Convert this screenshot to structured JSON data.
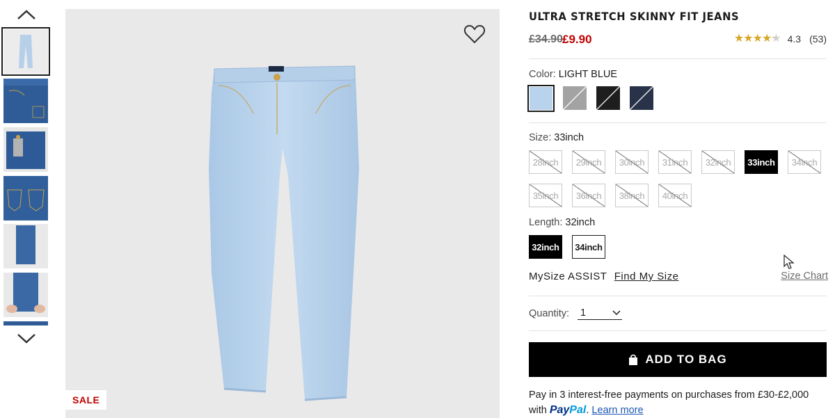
{
  "product": {
    "title": "ULTRA STRETCH SKINNY FIT JEANS",
    "price_original": "£34.90",
    "price_sale": "£9.90",
    "rating_value": "4.3",
    "rating_count": "(53)",
    "rating_stars": 4.3,
    "sale_badge": "SALE"
  },
  "color": {
    "label": "Color:",
    "selected": "LIGHT BLUE",
    "swatches": [
      {
        "name": "light-blue",
        "hex": "#b9d3ec",
        "available": true,
        "selected": true
      },
      {
        "name": "gray",
        "hex": "#a3a3a3",
        "available": false,
        "selected": false
      },
      {
        "name": "black",
        "hex": "#1e1e1e",
        "available": false,
        "selected": false
      },
      {
        "name": "navy",
        "hex": "#283349",
        "available": false,
        "selected": false
      }
    ]
  },
  "size": {
    "label": "Size:",
    "selected": "33inch",
    "options": [
      {
        "label": "28inch",
        "state": "oos"
      },
      {
        "label": "29inch",
        "state": "oos"
      },
      {
        "label": "30inch",
        "state": "oos"
      },
      {
        "label": "31inch",
        "state": "oos"
      },
      {
        "label": "32inch",
        "state": "oos"
      },
      {
        "label": "33inch",
        "state": "selected"
      },
      {
        "label": "34inch",
        "state": "oos"
      },
      {
        "label": "35inch",
        "state": "oos"
      },
      {
        "label": "36inch",
        "state": "oos"
      },
      {
        "label": "38inch",
        "state": "oos"
      },
      {
        "label": "40inch",
        "state": "oos"
      }
    ]
  },
  "length": {
    "label": "Length:",
    "selected": "32inch",
    "options": [
      {
        "label": "32inch",
        "state": "selected"
      },
      {
        "label": "34inch",
        "state": "avail"
      }
    ]
  },
  "mysize": {
    "label": "MySize ASSIST",
    "link": "Find My Size",
    "size_chart": "Size Chart"
  },
  "quantity": {
    "label": "Quantity:",
    "value": "1"
  },
  "cart": {
    "add_label": "ADD TO BAG"
  },
  "paypal": {
    "text": "Pay in 3 interest-free payments on purchases from £30-£2,000 with",
    "brand_pay": "Pay",
    "brand_pal": "Pal",
    "learn_more": "Learn more"
  },
  "thumbnails": [
    {
      "name": "front-light",
      "selected": true
    },
    {
      "name": "front-denim",
      "selected": false
    },
    {
      "name": "waist-detail",
      "selected": false
    },
    {
      "name": "back-pocket",
      "selected": false
    },
    {
      "name": "leg-hem",
      "selected": false
    },
    {
      "name": "hand-stretch",
      "selected": false
    },
    {
      "name": "partial",
      "selected": false
    }
  ],
  "icons": {
    "up": "chevron-up-icon",
    "down": "chevron-down-icon",
    "wishlist": "heart-icon",
    "bag": "shopping-bag-icon"
  },
  "colors": {
    "sale_red": "#c00000",
    "primary_black": "#000000",
    "paypal_blue": "#003087",
    "link_blue": "#1a57b4"
  }
}
